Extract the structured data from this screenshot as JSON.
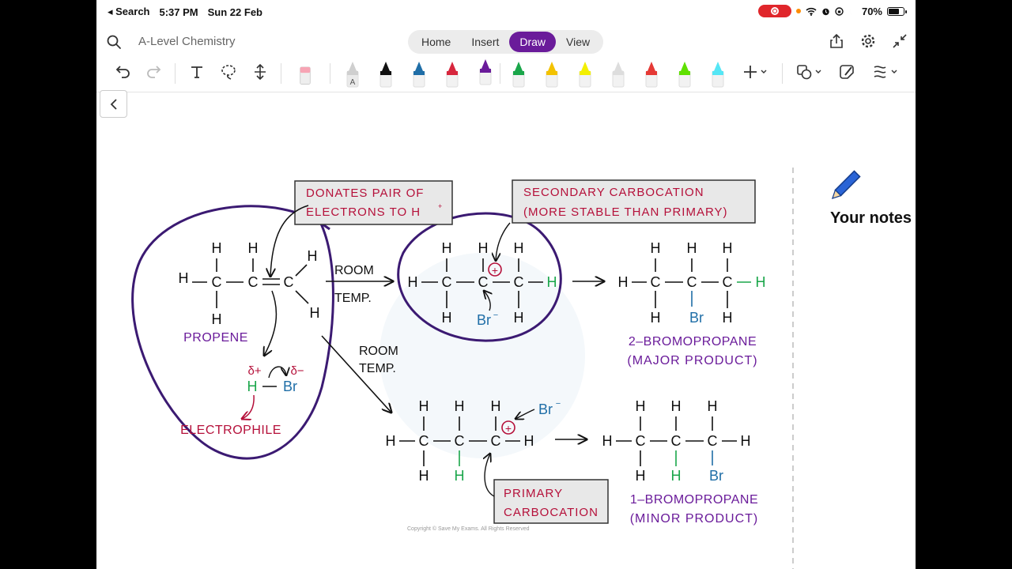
{
  "status_bar": {
    "back_app": "◂ Search",
    "time": "5:37 PM",
    "date": "Sun 22 Feb",
    "battery": "70%",
    "battery_level": 0.7
  },
  "title_row": {
    "document_title": "A-Level Chemistry",
    "tabs": [
      {
        "label": "Home",
        "active": false
      },
      {
        "label": "Insert",
        "active": false
      },
      {
        "label": "Draw",
        "active": true
      },
      {
        "label": "View",
        "active": false
      }
    ],
    "accent_color": "#6a1b9a"
  },
  "toolbar": {
    "pen_label": "A",
    "pen_colors": [
      "#111111",
      "#1f6ea7",
      "#d7263d",
      "#6a1b9a",
      "#1aa64a",
      "#f3c200",
      "#f3ef00",
      "#dddddd",
      "#e53935",
      "#5fe000",
      "#55e6f5"
    ]
  },
  "side_panel": {
    "label": "Your notes"
  },
  "diagram": {
    "box_donates_1": "DONATES PAIR OF",
    "box_donates_2": "ELECTRONS TO H",
    "box_donates_sup": "+",
    "box_secondary_1": "SECONDARY CARBOCATION",
    "box_secondary_2": "(MORE STABLE THAN PRIMARY)",
    "box_primary_1": "PRIMARY",
    "box_primary_2": "CARBOCATION",
    "room_1": "ROOM",
    "temp_1": "TEMP.",
    "room_2": "ROOM",
    "temp_2": "TEMP.",
    "propene": "PROPENE",
    "electrophile": "ELECTROPHILE",
    "delta_plus": "δ+",
    "delta_minus": "δ−",
    "h_atom": "H",
    "c_atom": "C",
    "br_atom": "Br",
    "br_ion": "Br",
    "ion_minus": "−",
    "plus": "+",
    "product_major_name": "2–BROMOPROPANE",
    "product_major_note": "(MAJOR PRODUCT)",
    "product_minor_name": "1–BROMOPROPANE",
    "product_minor_note": "(MINOR PRODUCT)",
    "copyright": "Copyright © Save My Exams. All Rights Reserved"
  }
}
